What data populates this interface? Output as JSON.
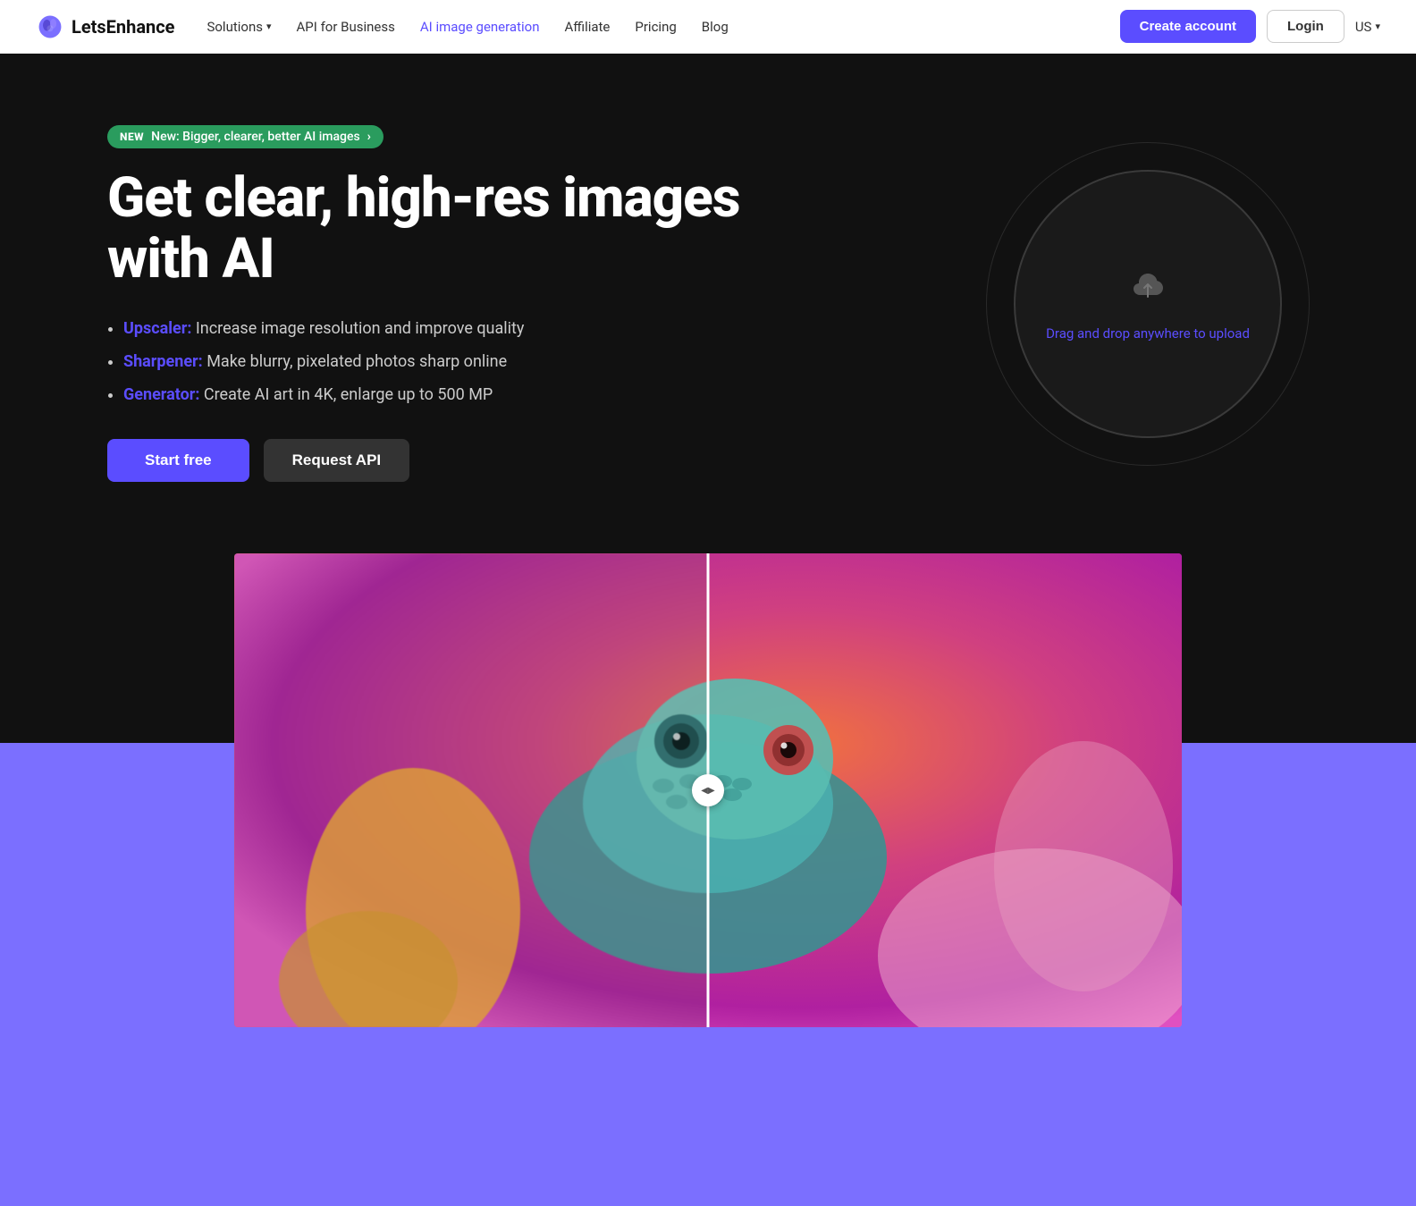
{
  "brand": {
    "name": "LetsEnhance",
    "logo_alt": "LetsEnhance logo"
  },
  "nav": {
    "links": [
      {
        "id": "solutions",
        "label": "Solutions",
        "has_dropdown": true,
        "active": false
      },
      {
        "id": "api",
        "label": "API for Business",
        "has_dropdown": false,
        "active": false
      },
      {
        "id": "ai-image",
        "label": "AI image generation",
        "has_dropdown": false,
        "active": true
      },
      {
        "id": "affiliate",
        "label": "Affiliate",
        "has_dropdown": false,
        "active": false
      },
      {
        "id": "pricing",
        "label": "Pricing",
        "has_dropdown": false,
        "active": false
      },
      {
        "id": "blog",
        "label": "Blog",
        "has_dropdown": false,
        "active": false
      }
    ],
    "create_account": "Create account",
    "login": "Login",
    "locale": "US"
  },
  "hero": {
    "badge_new": "NEW",
    "badge_text": "New: Bigger, clearer, better AI images",
    "title": "Get clear, high-res images with AI",
    "features": [
      {
        "label": "Upscaler:",
        "text": "Increase image resolution and improve quality"
      },
      {
        "label": "Sharpener:",
        "text": "Make blurry, pixelated photos sharp online"
      },
      {
        "label": "Generator:",
        "text": "Create AI art in 4K, enlarge up to 500 MP"
      }
    ],
    "cta_start": "Start free",
    "cta_api": "Request API"
  },
  "upload": {
    "text": "Drag and drop anywhere ",
    "link_text": "to upload"
  },
  "comparison": {
    "enabled": true
  },
  "colors": {
    "accent": "#5b4dff",
    "badge_green": "#2a9c5e",
    "dark_bg": "#111111",
    "purple_bottom": "#7b6fff"
  }
}
